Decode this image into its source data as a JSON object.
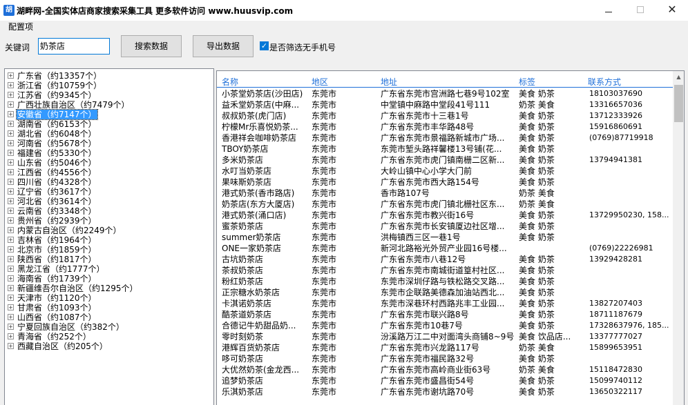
{
  "window": {
    "icon_text": "胡",
    "title": "湖畔网-全国实体店商家搜索采集工具   更多软件访问 www.huusvip.com",
    "close_glyph": "✕"
  },
  "config": {
    "group_label": "配置项",
    "keyword_label": "关键词",
    "keyword_value": "奶茶店",
    "search_button": "搜索数据",
    "export_button": "导出数据",
    "filter_checked": true,
    "filter_label": "是否筛选无手机号"
  },
  "tree": {
    "expand_glyph": "+",
    "items": [
      {
        "label": "广东省（约13357个）"
      },
      {
        "label": "浙江省（约10759个）"
      },
      {
        "label": "江苏省（约9345个）"
      },
      {
        "label": "广西壮族自治区（约7479个）"
      },
      {
        "label": "安徽省（约7147个）",
        "selected": true
      },
      {
        "label": "湖南省（约6153个）"
      },
      {
        "label": "湖北省（约6048个）"
      },
      {
        "label": "河南省（约5678个）"
      },
      {
        "label": "福建省（约5330个）"
      },
      {
        "label": "山东省（约5046个）"
      },
      {
        "label": "江西省（约4556个）"
      },
      {
        "label": "四川省（约4328个）"
      },
      {
        "label": "辽宁省（约3617个）"
      },
      {
        "label": "河北省（约3614个）"
      },
      {
        "label": "云南省（约3348个）"
      },
      {
        "label": "贵州省（约2939个）"
      },
      {
        "label": "内蒙古自治区（约2249个）"
      },
      {
        "label": "吉林省（约1964个）"
      },
      {
        "label": "北京市（约1859个）"
      },
      {
        "label": "陕西省（约1817个）"
      },
      {
        "label": "黑龙江省（约1777个）"
      },
      {
        "label": "海南省（约1739个）"
      },
      {
        "label": "新疆维吾尔自治区（约1295个）"
      },
      {
        "label": "天津市（约1120个）"
      },
      {
        "label": "甘肃省（约1093个）"
      },
      {
        "label": "山西省（约1087个）"
      },
      {
        "label": "宁夏回族自治区（约382个）"
      },
      {
        "label": "青海省（约252个）"
      },
      {
        "label": "西藏自治区（约205个）"
      }
    ]
  },
  "table": {
    "headers": {
      "name": "名称",
      "area": "地区",
      "address": "地址",
      "tags": "标签",
      "contact": "联系方式"
    },
    "rows": [
      {
        "name": "小茶堂奶茶店(沙田店)",
        "area": "东莞市",
        "address": "广东省东莞市宫洲路七巷9号102室",
        "tags": "美食 奶茶",
        "contact": "18103037690"
      },
      {
        "name": "益禾堂奶茶店(中麻...",
        "area": "东莞市",
        "address": "中堂镇中麻路中堂段41号111",
        "tags": "奶茶 美食",
        "contact": "13316657036"
      },
      {
        "name": "叔叔奶茶(虎门店)",
        "area": "东莞市",
        "address": "广东省东莞市十三巷1号",
        "tags": "美食 奶茶",
        "contact": "13712333926"
      },
      {
        "name": "柠檬Mr乐喜悦奶茶...",
        "area": "东莞市",
        "address": "广东省东莞市丰华路48号",
        "tags": "美食 奶茶",
        "contact": "15916860691"
      },
      {
        "name": "香港祥会咖啡奶茶店",
        "area": "东莞市",
        "address": "广东省东莞市景福路新城市广场...",
        "tags": "美食 奶茶",
        "contact": "(0769)87719918"
      },
      {
        "name": "TBOY奶茶店",
        "area": "东莞市",
        "address": "东莞市堑头路祥馨楼13号铺(花...",
        "tags": "美食 奶茶",
        "contact": ""
      },
      {
        "name": "多米奶茶店",
        "area": "东莞市",
        "address": "广东省东莞市虎门镇南栅二区新...",
        "tags": "美食 奶茶",
        "contact": "13794941381"
      },
      {
        "name": "水叮当奶茶店",
        "area": "东莞市",
        "address": "大岭山镇中心小学大门前",
        "tags": "美食 奶茶",
        "contact": ""
      },
      {
        "name": "果味斯奶茶店",
        "area": "东莞市",
        "address": "广东省东莞市西大路154号",
        "tags": "美食 奶茶",
        "contact": ""
      },
      {
        "name": "港式奶茶(香市路店)",
        "area": "东莞市",
        "address": "香市路107号",
        "tags": "奶茶 美食",
        "contact": ""
      },
      {
        "name": "奶茶店(东方大厦店)",
        "area": "东莞市",
        "address": "广东省东莞市虎门镇北栅社区东...",
        "tags": "奶茶 美食",
        "contact": ""
      },
      {
        "name": "港式奶茶(涌口店)",
        "area": "东莞市",
        "address": "广东省东莞市教兴街16号",
        "tags": "美食 奶茶",
        "contact": "13729950230, 158..."
      },
      {
        "name": "蜜茶奶茶店",
        "area": "东莞市",
        "address": "广东省东莞市长安镇厦边社区增...",
        "tags": "美食 奶茶",
        "contact": ""
      },
      {
        "name": "summer奶茶店",
        "area": "东莞市",
        "address": "洪梅镇西三区一巷1号",
        "tags": "美食 奶茶",
        "contact": ""
      },
      {
        "name": "ONE一家奶茶店",
        "area": "东莞市",
        "address": "新河北路裕光外贸产业园16号楼...",
        "tags": "",
        "contact": "(0769)22226981"
      },
      {
        "name": "古坑奶茶店",
        "area": "东莞市",
        "address": "广东省东莞市八巷12号",
        "tags": "美食 奶茶",
        "contact": "13929428281"
      },
      {
        "name": "茶叔奶茶店",
        "area": "东莞市",
        "address": "广东省东莞市南城街道篁村社区...",
        "tags": "美食 奶茶",
        "contact": ""
      },
      {
        "name": "粉红奶茶店",
        "area": "东莞市",
        "address": "东莞市深圳仔路与铁松路交叉路...",
        "tags": "美食 奶茶",
        "contact": ""
      },
      {
        "name": "正宗糖水奶茶店",
        "area": "东莞市",
        "address": "东莞市企联路美德森加油站西北...",
        "tags": "美食 奶茶",
        "contact": ""
      },
      {
        "name": "卡淇诺奶茶店",
        "area": "东莞市",
        "address": "东莞市深巷环村西路兆丰工业园...",
        "tags": "美食 奶茶",
        "contact": "13827207403"
      },
      {
        "name": "酷茶道奶茶店",
        "area": "东莞市",
        "address": "广东省东莞市联兴路8号",
        "tags": "美食 奶茶",
        "contact": "18711187679"
      },
      {
        "name": "合德记牛奶甜品奶...",
        "area": "东莞市",
        "address": "广东省东莞市10巷7号",
        "tags": "美食 奶茶",
        "contact": "17328637976, 185..."
      },
      {
        "name": "零时刻奶茶",
        "area": "东莞市",
        "address": "汾溪路万江二中对面湾头商铺8~9号",
        "tags": "美食 饮品店...",
        "contact": "13377777027"
      },
      {
        "name": "港辉百货奶茶店",
        "area": "东莞市",
        "address": "广东省东莞市兴龙路117号",
        "tags": "奶茶 美食",
        "contact": "15899653951"
      },
      {
        "name": "哆可奶茶店",
        "area": "东莞市",
        "address": "广东省东莞市福民路32号",
        "tags": "美食 奶茶",
        "contact": ""
      },
      {
        "name": "大优然奶茶(金龙西...",
        "area": "东莞市",
        "address": "广东省东莞市高岭商业街63号",
        "tags": "奶茶 美食",
        "contact": "15118472830"
      },
      {
        "name": "追梦奶茶店",
        "area": "东莞市",
        "address": "广东省东莞市盛昌街54号",
        "tags": "美食 奶茶",
        "contact": "15099740112"
      },
      {
        "name": "乐淇奶茶店",
        "area": "东莞市",
        "address": "广东省东莞市谢坑路70号",
        "tags": "美食 奶茶",
        "contact": "13650322117"
      }
    ]
  }
}
